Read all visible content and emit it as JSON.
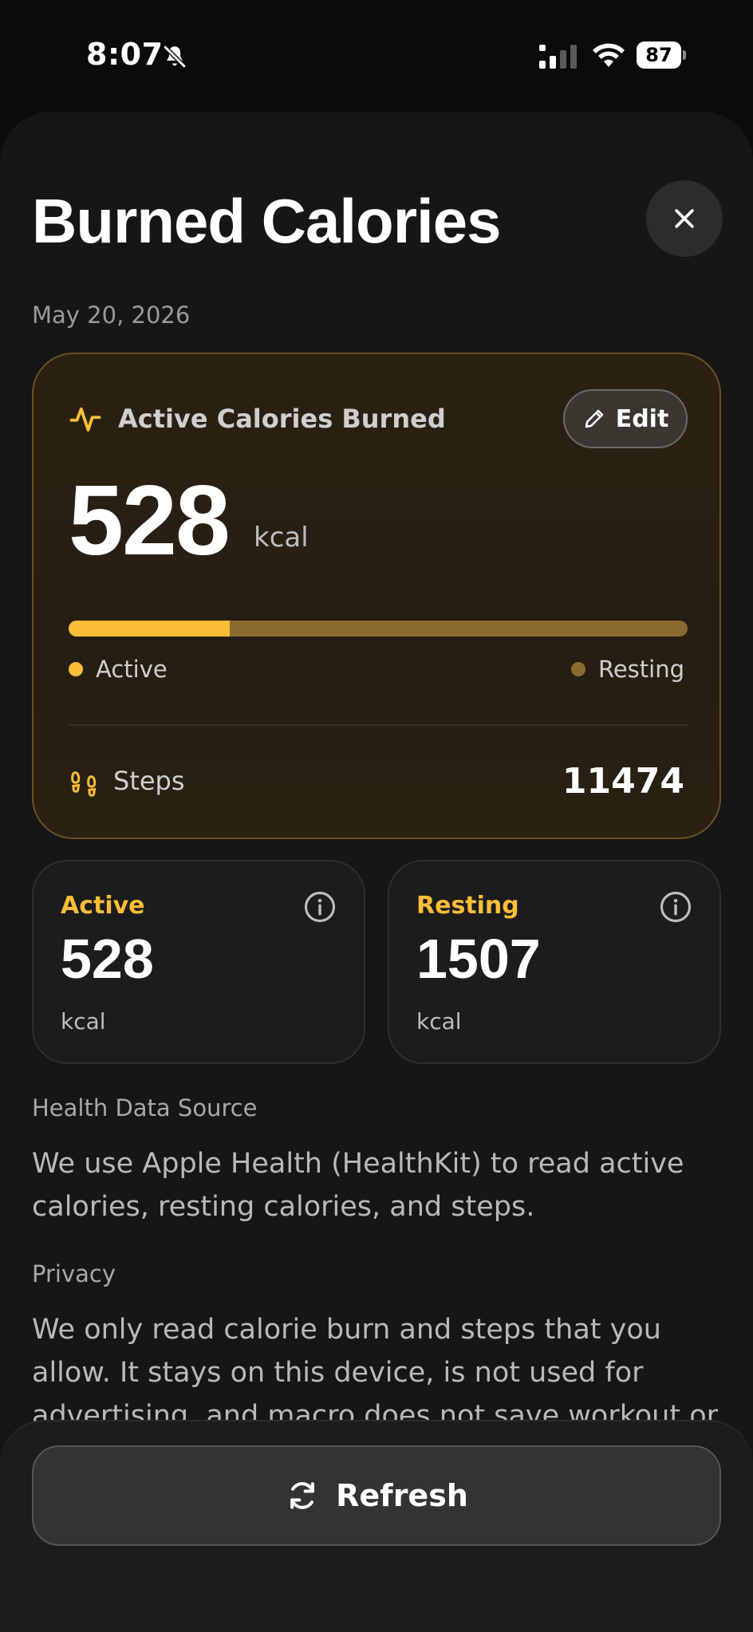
{
  "status_bar": {
    "time": "8:07",
    "battery": "87"
  },
  "header": {
    "title": "Burned Calories",
    "date": "May 20, 2026"
  },
  "main_card": {
    "label": "Active Calories Burned",
    "edit_label": "Edit",
    "value": "528",
    "unit": "kcal",
    "active_fraction": 0.26,
    "legend_active": "Active",
    "legend_resting": "Resting",
    "steps_label": "Steps",
    "steps_value": "11474"
  },
  "cards": {
    "active": {
      "title": "Active",
      "value": "528",
      "unit": "kcal"
    },
    "resting": {
      "title": "Resting",
      "value": "1507",
      "unit": "kcal"
    }
  },
  "sections": {
    "source_heading": "Health Data Source",
    "source_text": "We use Apple Health (HealthKit) to read active calories, resting calories, and steps.",
    "privacy_heading": "Privacy",
    "privacy_text": "We only read calorie burn and steps that you allow. It stays on this device, is not used for advertising, and macro does not save workout or health data."
  },
  "footer": {
    "refresh_label": "Refresh"
  },
  "colors": {
    "accent": "#fbbd36",
    "resting_bar": "#8a6a2e",
    "background": "#161616"
  },
  "icons": [
    "bell-slash-icon",
    "signal-icon",
    "wifi-icon",
    "close-icon",
    "pulse-icon",
    "pencil-icon",
    "footsteps-icon",
    "info-icon",
    "refresh-icon"
  ]
}
